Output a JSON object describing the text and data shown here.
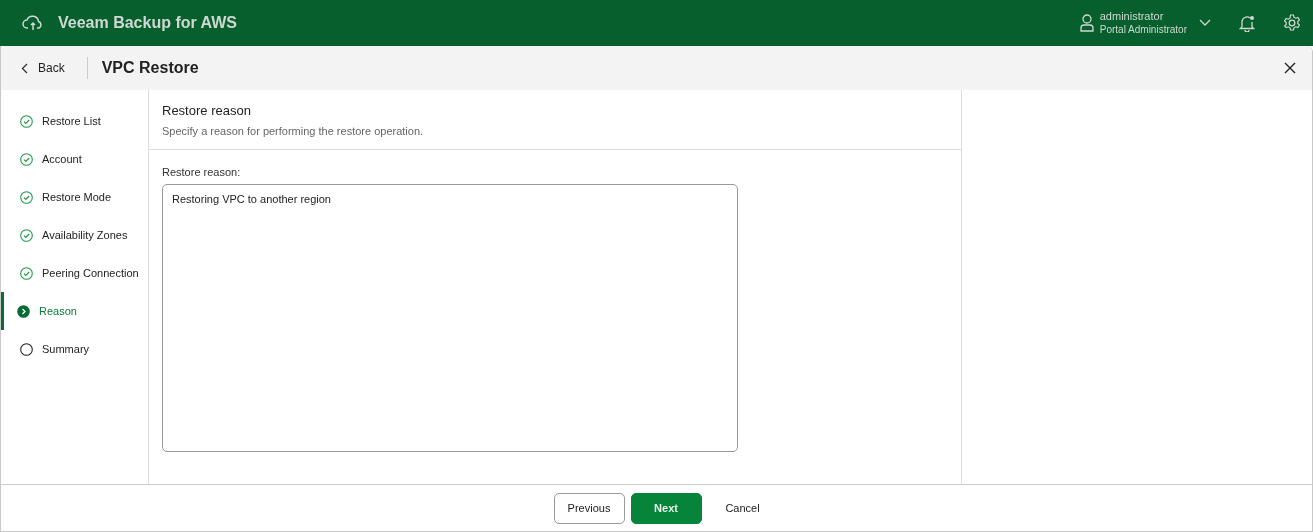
{
  "app": {
    "title": "Veeam Backup for AWS",
    "user": {
      "name": "administrator",
      "role": "Portal Administrator"
    }
  },
  "dialog": {
    "back": "Back",
    "title": "VPC Restore"
  },
  "steps": [
    {
      "label": "Restore List",
      "kind": "done",
      "selected": false
    },
    {
      "label": "Account",
      "kind": "done",
      "selected": false
    },
    {
      "label": "Restore Mode",
      "kind": "done",
      "selected": false
    },
    {
      "label": "Availability Zones",
      "kind": "done",
      "selected": false
    },
    {
      "label": "Peering Connection",
      "kind": "done",
      "selected": false
    },
    {
      "label": "Reason",
      "kind": "current",
      "selected": true
    },
    {
      "label": "Summary",
      "kind": "pending",
      "selected": false
    }
  ],
  "section": {
    "title": "Restore reason",
    "description": "Specify a reason for performing the restore operation."
  },
  "field": {
    "label": "Restore reason:",
    "value": "Restoring VPC to another region"
  },
  "buttons": [
    {
      "label": "Previous",
      "kind": "secondary"
    },
    {
      "label": "Next",
      "kind": "primary"
    },
    {
      "label": "Cancel",
      "kind": "plain"
    }
  ]
}
